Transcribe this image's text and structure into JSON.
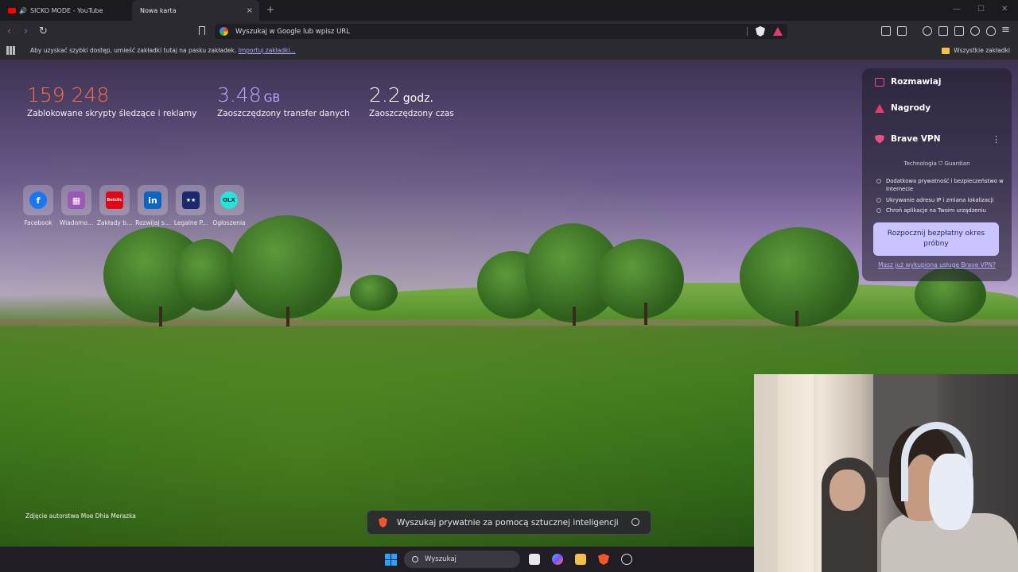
{
  "tabs": [
    {
      "title": "SICKO MODE - YouTube"
    },
    {
      "title": "Nowa karta"
    }
  ],
  "new_tab_symbol": "+",
  "close_symbol": "×",
  "window_controls": {
    "minimize": "—",
    "maximize": "☐",
    "close": "✕"
  },
  "address_bar": {
    "placeholder": "Wyszukaj w Google lub wpisz URL"
  },
  "bookmarks_bar": {
    "message": "Aby uzyskać szybki dostęp, umieść zakładki tutaj na pasku zakładek.",
    "import_link": "Importuj zakładki...",
    "all_bookmarks": "Wszystkie zakładki"
  },
  "stats": [
    {
      "value": "159 248",
      "unit": "",
      "label": "Zablokowane skrypty śledzące i reklamy"
    },
    {
      "value": "3.48",
      "unit": "GB",
      "label": "Zaoszczędzony transfer danych"
    },
    {
      "value": "2.2",
      "unit": "godz.",
      "label": "Zaoszczędzony czas"
    }
  ],
  "top_sites": [
    {
      "name": "Facebook",
      "glyph": "f",
      "color": "#1877f2"
    },
    {
      "name": "Wiadomo...",
      "glyph": "▦",
      "color": "#9b59b6"
    },
    {
      "name": "Zakłady b...",
      "glyph": "Betclic",
      "color": "#e30613"
    },
    {
      "name": "Rozwijaj s...",
      "glyph": "in",
      "color": "#0a66c2"
    },
    {
      "name": "Legalne P...",
      "glyph": "★★",
      "color": "#1a2a6c"
    },
    {
      "name": "Ogłoszenia",
      "glyph": "OLX",
      "color": "#23e5db"
    }
  ],
  "panel": {
    "chat": "Rozmawiaj",
    "rewards": "Nagrody",
    "vpn_title": "Brave VPN",
    "tech": "Technologia ⛉ Guardian",
    "features": [
      "Dodatkowa prywatność i bezpieczeństwo w Internecie",
      "Ukrywanie adresu IP i zmiana lokalizacji",
      "Chroń aplikacje na Twoim urządzeniu"
    ],
    "trial_button": "Rozpocznij bezpłatny okres próbny",
    "already_link": "Masz już wykupioną usługę Brave VPN?"
  },
  "photo_credit": "Zdjęcie autorstwa Moe Dhia Merazka",
  "ai_search": {
    "placeholder": "Wyszukaj prywatnie za pomocą sztucznej inteligencji"
  },
  "taskbar": {
    "search": "Wyszukaj"
  },
  "colors": {
    "accent": "#e8508a",
    "blocked": "#ff6a4c",
    "bandwidth": "#b6a8ff",
    "trial_button": "#c9c4ff"
  }
}
